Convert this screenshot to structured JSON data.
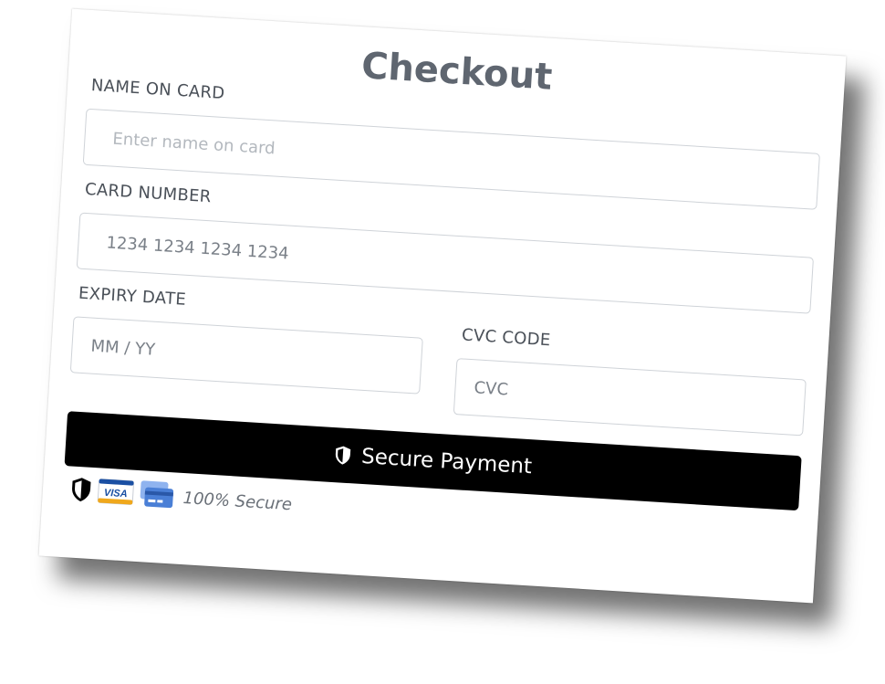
{
  "checkout": {
    "title": "Checkout",
    "name_label": "NAME ON CARD",
    "name_placeholder": "Enter name on card",
    "card_label": "CARD NUMBER",
    "card_placeholder": "1234 1234 1234 1234",
    "expiry_label": "EXPIRY DATE",
    "expiry_placeholder": "MM / YY",
    "cvc_label": "CVC CODE",
    "cvc_placeholder": "CVC",
    "pay_button": "Secure Payment",
    "secure_text": "100% Secure",
    "icons": [
      "shield-icon",
      "visa-card-icon",
      "credit-card-icon"
    ],
    "colors": {
      "button_bg": "#000000",
      "title": "#5f6670",
      "visa_blue": "#1a4fa3",
      "visa_gold": "#f0a81c",
      "card_blue": "#4a7fd6"
    }
  }
}
